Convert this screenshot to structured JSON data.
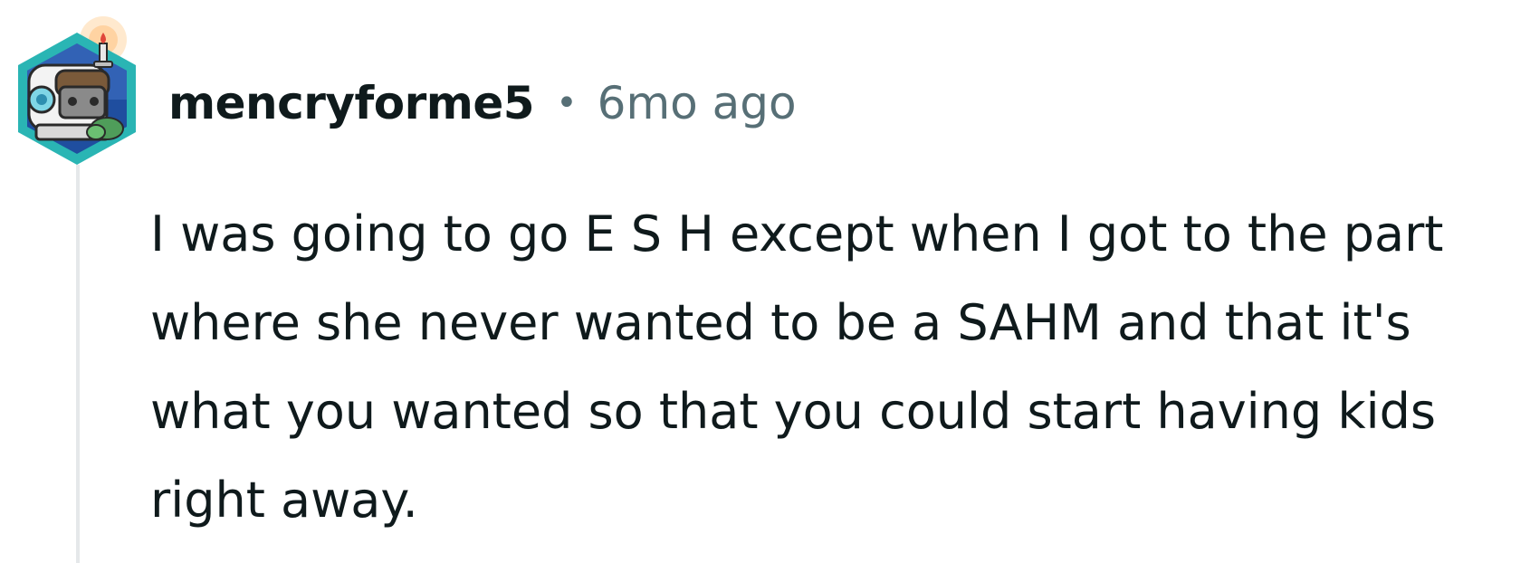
{
  "comment": {
    "username": "mencryforme5",
    "separator": "•",
    "timestamp": "6mo ago",
    "body": "I was going to go E S H except when I got to the part where she never wanted to be a SAHM and that it's what you wanted so that you could start having kids right away."
  },
  "avatar": {
    "icon": "snoo-avatar-icon",
    "colors": {
      "hex_outer": "#2bb6b6",
      "hex_inner": "#1e4fa8",
      "bubble": "#f4f4f4",
      "candle_glow": "#ffd7a8"
    }
  }
}
